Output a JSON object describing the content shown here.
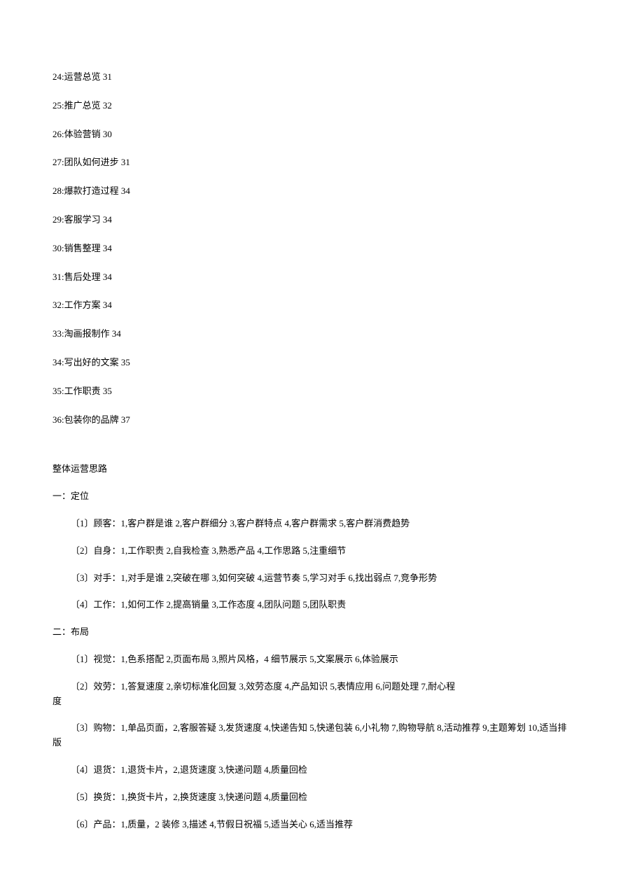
{
  "toc": [
    "24:运营总览 31",
    "25:推广总览 32",
    "26:体验营销 30",
    "27:团队如何进步 31",
    "28:爆款打造过程 34",
    "29:客服学习 34",
    "30:销售整理 34",
    "31:售后处理 34",
    "32:工作方案 34",
    "33:淘画报制作 34",
    "34:写出好的文案 35",
    "35:工作职责 35",
    "36:包装你的品牌 37"
  ],
  "sectionTitle": "整体运营思路",
  "sec1": {
    "heading": "一：定位",
    "items": [
      "〔1〕顾客：1,客户群是谁 2,客户群细分 3,客户群特点 4,客户群需求 5,客户群消费趋势",
      "〔2〕自身：1,工作职责 2,自我检查 3,熟悉产品 4,工作思路 5,注重细节",
      "〔3〕对手：1,对手是谁 2,突破在哪 3,如何突破 4,运营节奏 5,学习对手 6,找出弱点 7,竞争形势",
      "〔4〕工作：1,如何工作 2,提高销量 3,工作态度 4,团队问题 5,团队职责"
    ]
  },
  "sec2": {
    "heading": "二：布局",
    "items": [
      {
        "first": "〔1〕视觉：1,色系搭配 2,页面布局 3,照片风格，4 细节展示 5,文案展示 6,体验展示",
        "cont": null
      },
      {
        "first": "〔2〕效劳：1,答复速度 2,亲切标准化回复 3,效劳态度 4,产品知识 5,表情应用 6,问题处理 7,耐心程",
        "cont": "度"
      },
      {
        "first": "〔3〕购物：1,单品页面，2,客服答疑 3,发货速度 4,快递告知 5,快递包装 6,小礼物 7,购物导航 8,活动推荐 9,主题筹划 10,适当排",
        "cont": "版"
      },
      {
        "first": "〔4〕退货：1,退货卡片，2,退货速度 3,快递问题 4,质量回检",
        "cont": null
      },
      {
        "first": "〔5〕换货：1,换货卡片，2,换货速度 3,快递问题 4,质量回检",
        "cont": null
      },
      {
        "first": "〔6〕产品：1,质量，2 装修 3,描述 4,节假日祝福 5,适当关心 6,适当推荐",
        "cont": null
      }
    ]
  }
}
